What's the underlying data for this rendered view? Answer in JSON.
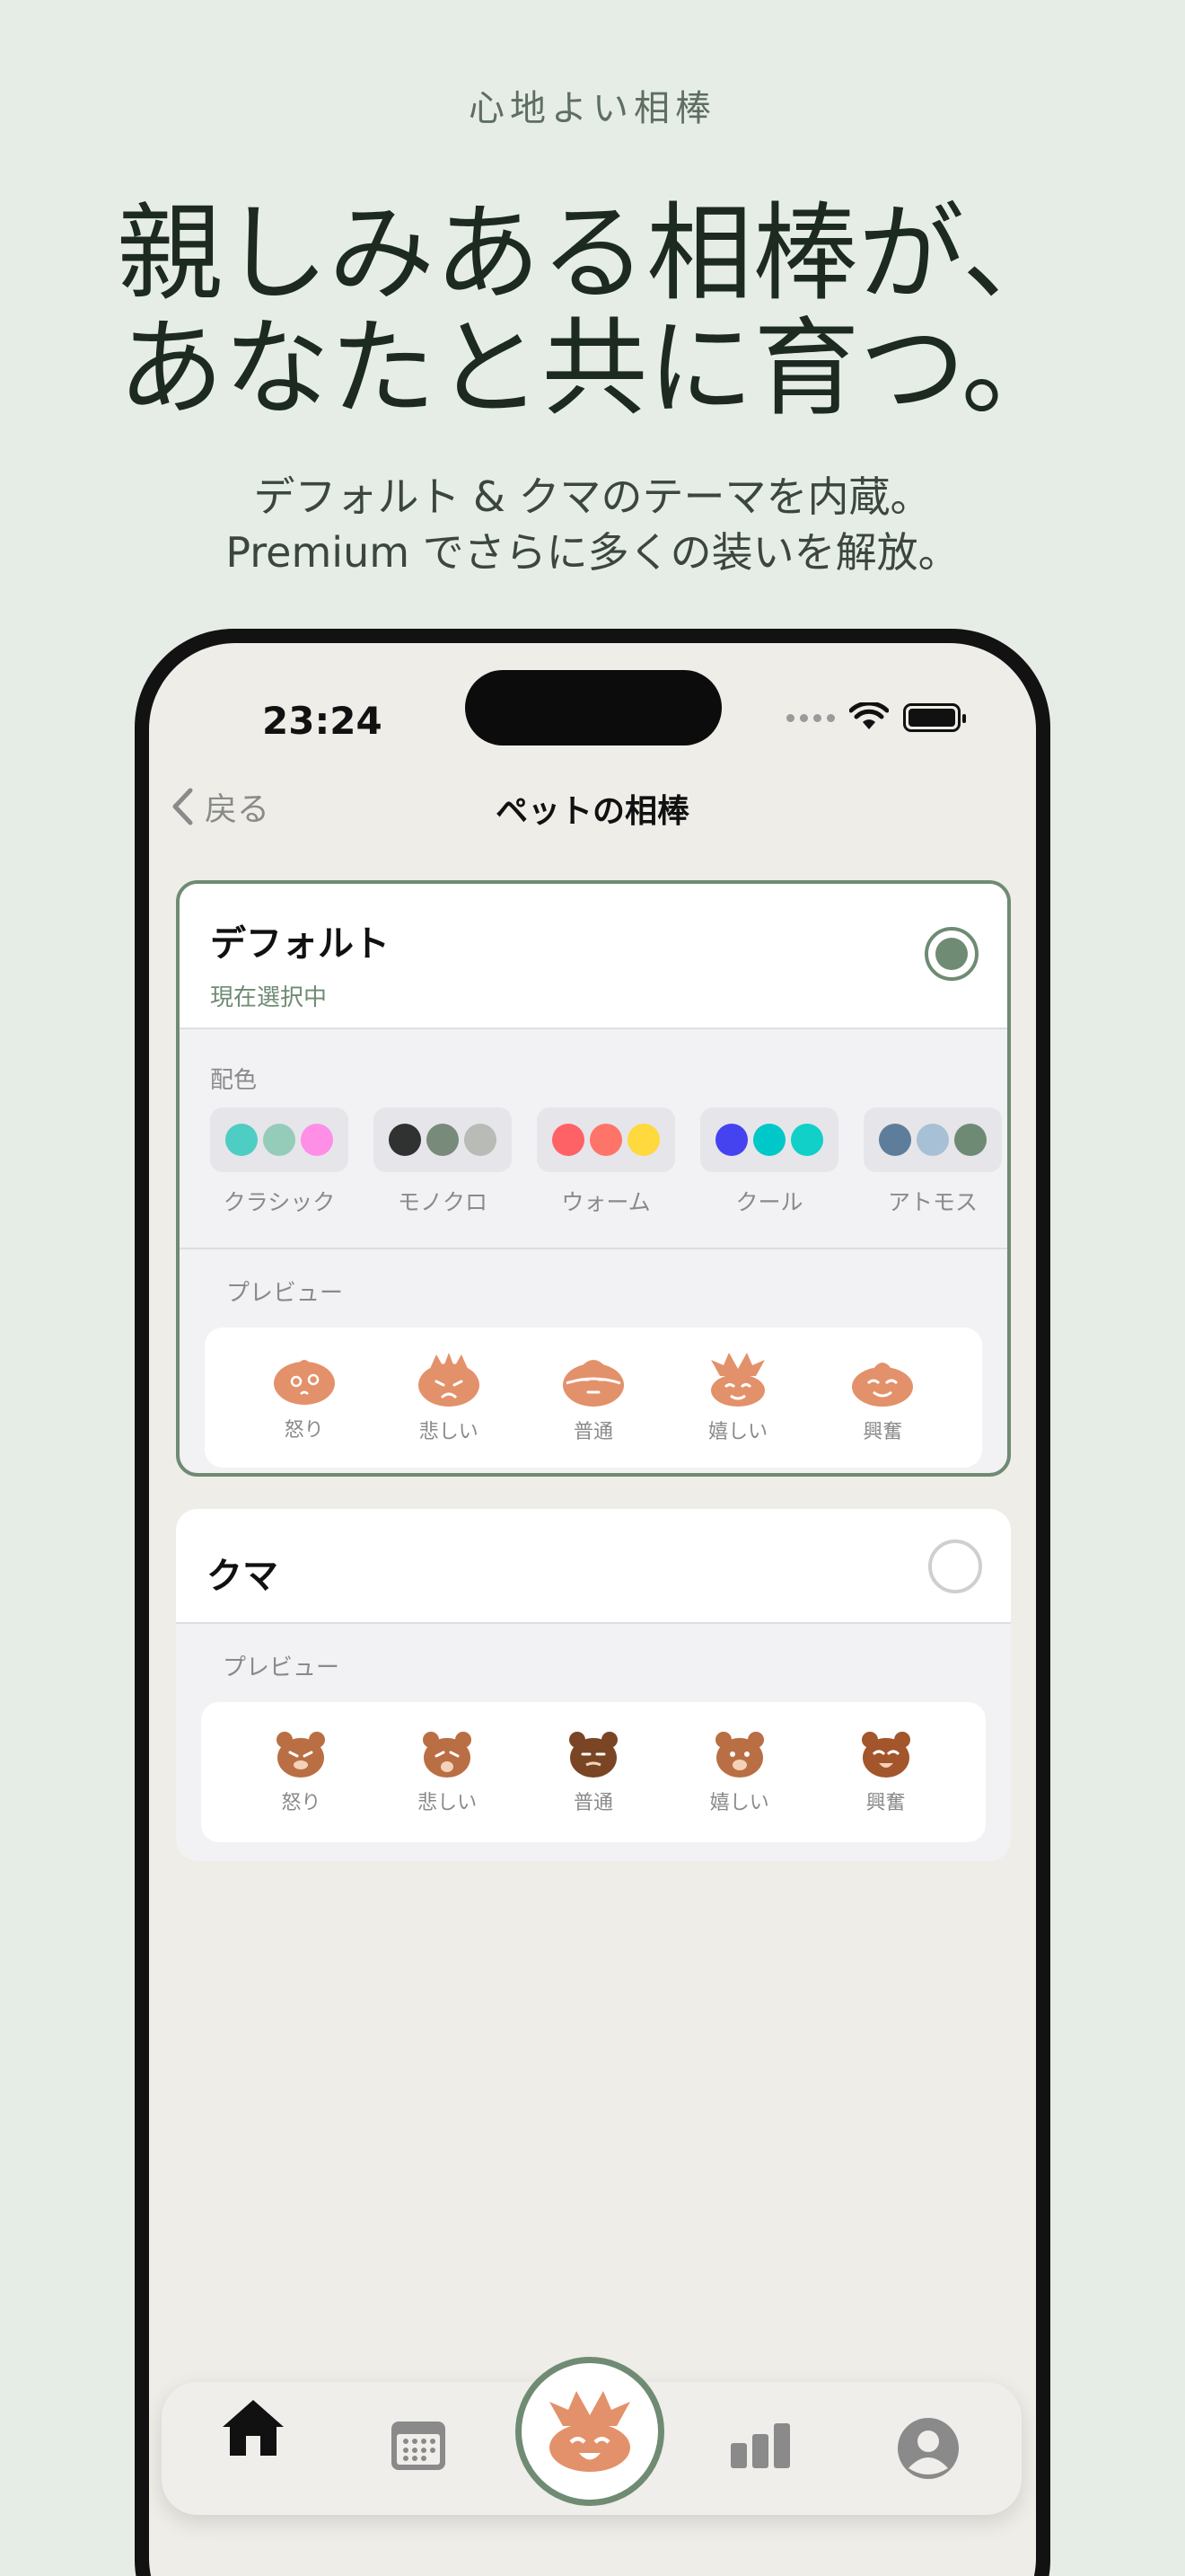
{
  "marketing": {
    "eyebrow": "心地よい相棒",
    "headline_line1": "親しみある相棒が、",
    "headline_line2": "あなたと共に育つ。",
    "sub_line1": "デフォルト & クマのテーマを内蔵。",
    "sub_line2": "Premium でさらに多くの装いを解放。"
  },
  "status_bar": {
    "time": "23:24"
  },
  "nav": {
    "back_label": "戻る",
    "title": "ペットの相棒"
  },
  "themes": [
    {
      "name": "デフォルト",
      "status": "現在選択中",
      "selected": true,
      "palette_label": "配色",
      "palettes": [
        {
          "name": "クラシック",
          "colors": [
            "#4ecdc4",
            "#95ccb9",
            "#ff8ee6"
          ]
        },
        {
          "name": "モノクロ",
          "colors": [
            "#2f3230",
            "#788a7a",
            "#b8bbb6"
          ]
        },
        {
          "name": "ウォーム",
          "colors": [
            "#ff6266",
            "#ff7468",
            "#ffd93d"
          ]
        },
        {
          "name": "クール",
          "colors": [
            "#4543f0",
            "#00c8c8",
            "#10d0c8"
          ]
        },
        {
          "name": "アトモス",
          "colors": [
            "#5e7d9a",
            "#a7c0d6",
            "#6e8a74"
          ]
        }
      ],
      "preview_label": "プレビュー",
      "moods": [
        "怒り",
        "悲しい",
        "普通",
        "嬉しい",
        "興奮"
      ]
    },
    {
      "name": "クマ",
      "selected": false,
      "preview_label": "プレビュー",
      "moods": [
        "怒り",
        "悲しい",
        "普通",
        "嬉しい",
        "興奮"
      ]
    }
  ],
  "colors": {
    "accent": "#6f8b73",
    "pet": "#e3916a",
    "bear": "#b96f43",
    "bear_dark": "#7a4524",
    "background": "#e6ede6"
  },
  "tabbar": {
    "icons": [
      "home-icon",
      "calendar-icon",
      "pet-icon",
      "stats-icon",
      "profile-icon"
    ]
  }
}
